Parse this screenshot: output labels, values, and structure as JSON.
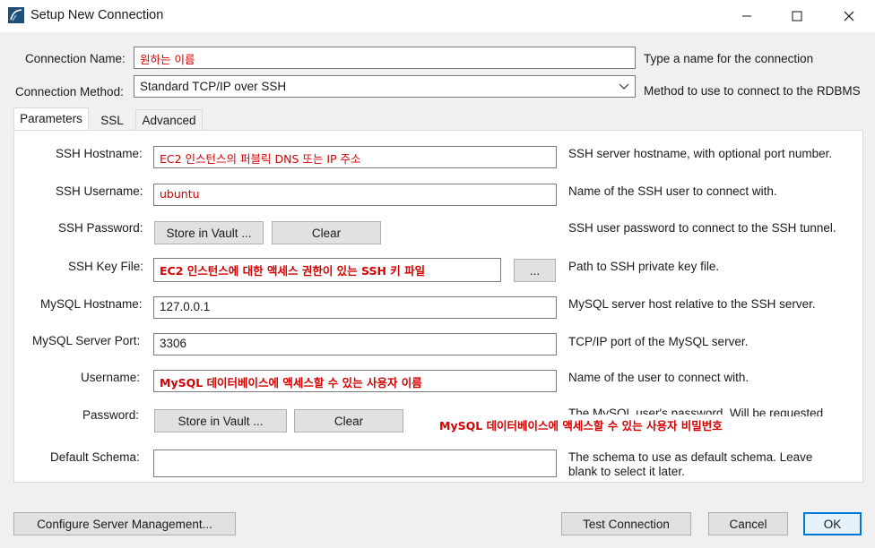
{
  "window": {
    "title": "Setup New Connection",
    "app_icon": "mysql-workbench-icon",
    "controls": {
      "minimize": "minimize-icon",
      "maximize": "maximize-icon",
      "close": "close-icon"
    }
  },
  "connection_name": {
    "label": "Connection Name:",
    "value": "원하는 이름",
    "hint": "Type a name for the connection"
  },
  "connection_method": {
    "label": "Connection Method:",
    "value": "Standard TCP/IP over SSH",
    "hint": "Method to use to connect to the RDBMS"
  },
  "tabs": [
    {
      "label": "Parameters",
      "active": true
    },
    {
      "label": "SSL",
      "active": false
    },
    {
      "label": "Advanced",
      "active": false
    }
  ],
  "params": {
    "ssh_hostname": {
      "label": "SSH Hostname:",
      "value": "EC2 인스턴스의 퍼블릭 DNS 또는 IP 주소",
      "hint": "SSH server hostname, with  optional port number."
    },
    "ssh_username": {
      "label": "SSH Username:",
      "value": "ubuntu",
      "hint": "Name of the SSH user to connect with."
    },
    "ssh_password": {
      "label": "SSH Password:",
      "store_label": "Store in Vault ...",
      "clear_label": "Clear",
      "hint": "SSH user password to connect to the SSH tunnel."
    },
    "ssh_key_file": {
      "label": "SSH Key File:",
      "value": "EC2 인스턴스에 대한 액세스 권한이 있는 SSH 키 파일",
      "browse_label": "...",
      "hint": "Path to SSH private key file."
    },
    "mysql_hostname": {
      "label": "MySQL Hostname:",
      "value": "127.0.0.1",
      "hint": "MySQL server host relative to the SSH server."
    },
    "mysql_port": {
      "label": "MySQL Server Port:",
      "value": "3306",
      "hint": "TCP/IP port of the MySQL server."
    },
    "username": {
      "label": "Username:",
      "value": "MySQL 데이터베이스에 액세스할 수 있는 사용자 이름",
      "hint": "Name of the user to connect with."
    },
    "password": {
      "label": "Password:",
      "store_label": "Store in Vault ...",
      "clear_label": "Clear",
      "hint_partial": "The MySQL user's password. Will be requested",
      "note": "MySQL 데이터베이스에 액세스할 수 있는 사용자 비밀번호"
    },
    "default_schema": {
      "label": "Default Schema:",
      "value": "",
      "hint_line1": "The schema to use as default schema. Leave",
      "hint_line2": "blank to select it later."
    }
  },
  "footer": {
    "configure_label": "Configure Server Management...",
    "test_label": "Test Connection",
    "cancel_label": "Cancel",
    "ok_label": "OK"
  },
  "colors": {
    "accent": "#0078d7",
    "annotation": "#d40000"
  }
}
